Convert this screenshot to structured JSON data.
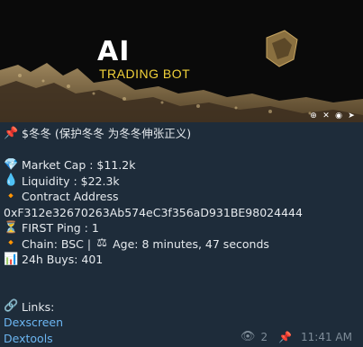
{
  "banner": {
    "title": "AI",
    "subtitle": "TRADING BOT",
    "social_icons": [
      "globe-icon",
      "x-icon",
      "discord-icon",
      "telegram-icon"
    ]
  },
  "message": {
    "title": "$冬冬 (保护冬冬 为冬冬伸张正义)",
    "market_cap": "Market Cap : $11.2k",
    "liquidity": "Liquidity : $22.3k",
    "contract_label": "Contract Address",
    "contract_address": "0xF312e32670263Ab574eC3f356aD931BE98024444",
    "first_ping": "FIRST Ping :  1",
    "chain": "Chain: BSC |",
    "age": "Age: 8 minutes, 47 seconds",
    "buys": "24h Buys: 401",
    "links_label": "Links:",
    "link_1": "Dexscreen",
    "link_2": "Dextools"
  },
  "meta": {
    "views": "2",
    "time": "11:41 AM"
  },
  "colors": {
    "background": "#1e2c3a",
    "link": "#6cb6f2",
    "accent_yellow": "#f2d23a",
    "meta_text": "#7e8c98"
  }
}
